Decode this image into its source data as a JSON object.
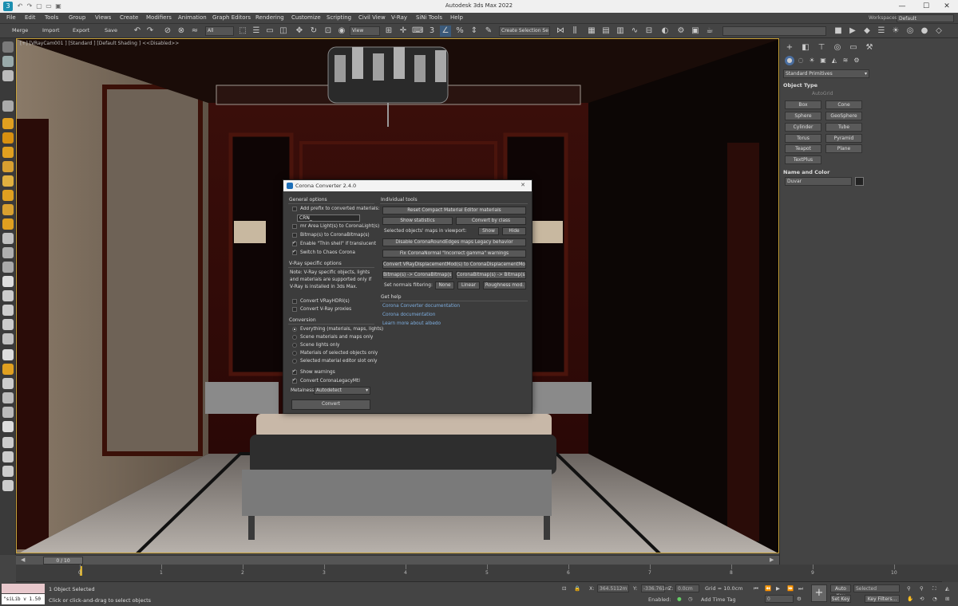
{
  "window": {
    "title": "Autodesk 3ds Max 2022",
    "min": "—",
    "max": "☐",
    "close": "✕"
  },
  "menu": [
    "File",
    "Edit",
    "Tools",
    "Group",
    "Views",
    "Create",
    "Modifiers",
    "Animation",
    "Graph Editors",
    "Rendering",
    "Customize",
    "Scripting",
    "Civil View",
    "V-Ray",
    "SiNi Tools",
    "Help"
  ],
  "workspaces": {
    "label": "Workspaces:",
    "value": "Default"
  },
  "toolbar": {
    "merge": "Merge",
    "import": "Import",
    "export": "Export",
    "save": "Save",
    "filter": "All",
    "refcoord": "View",
    "selset": "Create Selection Se"
  },
  "viewport": {
    "label": "[+] [VRayCam001 ] [Standard ] [Default Shading ]     <<Disabled>>"
  },
  "timeline": {
    "frame": "0 / 10",
    "ticks": [
      "0",
      "1",
      "2",
      "3",
      "4",
      "5",
      "6",
      "7",
      "8",
      "9",
      "10"
    ]
  },
  "status": {
    "maxscript": "\"siLib v 1.50",
    "selected": "1 Object Selected",
    "prompt": "Click or click-and-drag to select objects",
    "x_label": "X:",
    "x": "364.5112m",
    "y_label": "Y:",
    "y": "-336.761m",
    "z_label": "Z:",
    "z": "0.0cm",
    "grid": "Grid = 10.0cm",
    "enabled": "Enabled:",
    "addtimetag": "Add Time Tag",
    "autokey": "Auto Key",
    "setkey": "Set Key",
    "selected_dd": "Selected",
    "keyfilters": "Key Filters...",
    "frame": "0"
  },
  "cmdpanel": {
    "category": "Standard Primitives",
    "object_type": "Object Type",
    "autogrid": "AutoGrid",
    "primitives": [
      "Box",
      "Cone",
      "Sphere",
      "GeoSphere",
      "Cylinder",
      "Tube",
      "Torus",
      "Pyramid",
      "Teapot",
      "Plane",
      "TextPlus"
    ],
    "name_color": "Name and Color",
    "name": "Duvar"
  },
  "dialog": {
    "title": "Corona Converter 2.4.0",
    "general": "General options",
    "add_prefix": "Add prefix to converted materials:",
    "prefix": "CRN_",
    "mr_area": "mr Area Light(s) to CoronaLight(s)",
    "bitmap": "Bitmap(s) to CoronaBitmap(s)",
    "thin_shell": "Enable \"Thin shell\" if translucent",
    "chaos": "Switch to Chaos Corona",
    "vray": "V-Ray specific options",
    "vray_note": "Note: V-Ray specific objects, lights and materials are supported only if V-Ray is installed in 3ds Max.",
    "vray_hdri": "Convert VRayHDRI(s)",
    "vray_proxies": "Convert V-Ray proxies",
    "conversion": "Conversion",
    "conv_options": [
      "Everything (materials, maps, lights)",
      "Scene materials and maps only",
      "Scene lights only",
      "Materials of selected objects only",
      "Selected material editor slot only"
    ],
    "show_warnings": "Show warnings",
    "legacy": "Convert CoronaLegacyMtl",
    "metalness": "Metalness",
    "metalness_value": "Autodetect",
    "convert": "Convert",
    "individual": "Individual tools",
    "reset_cme": "Reset Compact Material Editor materials",
    "show_stats": "Show statistics",
    "convert_class": "Convert by class",
    "sel_maps": "Selected objects' maps in viewport:",
    "show": "Show",
    "hide": "Hide",
    "disable_round": "Disable CoronaRoundEdges maps Legacy behavior",
    "fix_normal": "Fix CoronaNormal \"Incorrect gamma\" warnings",
    "convert_disp": "Convert VRayDisplacementMod(s) to CoronaDisplacementMod(s)",
    "bm_to_cbm": "Bitmap(s) -> CoronaBitmap(s)",
    "cbm_to_bm": "CoronaBitmap(s) -> Bitmap(s)",
    "normals": "Set normals filtering:",
    "none": "None",
    "linear": "Linear",
    "roughness": "Roughness mod.",
    "help": "Get help",
    "doc_converter": "Corona Converter documentation",
    "doc_corona": "Corona documentation",
    "albedo": "Learn more about albedo"
  }
}
